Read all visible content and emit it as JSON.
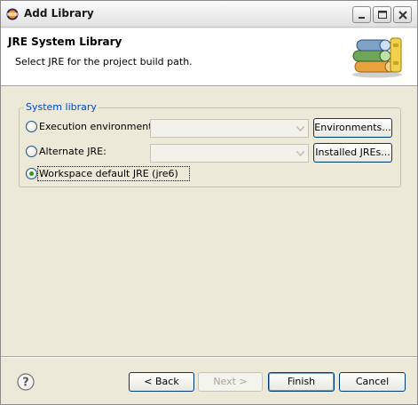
{
  "window": {
    "title": "Add Library",
    "title_icon": "eclipse-icon",
    "controls": [
      "minimize-icon",
      "maximize-icon",
      "close-icon"
    ]
  },
  "header": {
    "title": "JRE System Library",
    "subtitle": "Select JRE for the project build path.",
    "logo": "books-icon"
  },
  "system_library": {
    "group_label": "System library",
    "execution_environment": {
      "label": "Execution environment:",
      "selected": false,
      "combo_value": "",
      "button": "Environments..."
    },
    "alternate_jre": {
      "label": "Alternate JRE:",
      "selected": false,
      "combo_value": "",
      "button": "Installed JREs..."
    },
    "workspace_default": {
      "label": "Workspace default JRE (jre6)",
      "selected": true
    }
  },
  "footer": {
    "help_icon": "help-icon",
    "back": "< Back",
    "next": "Next >",
    "finish": "Finish",
    "cancel": "Cancel"
  },
  "colors": {
    "accent": "#0046d5",
    "radio_check": "#21a121",
    "window_bg": "#ece9d8"
  }
}
